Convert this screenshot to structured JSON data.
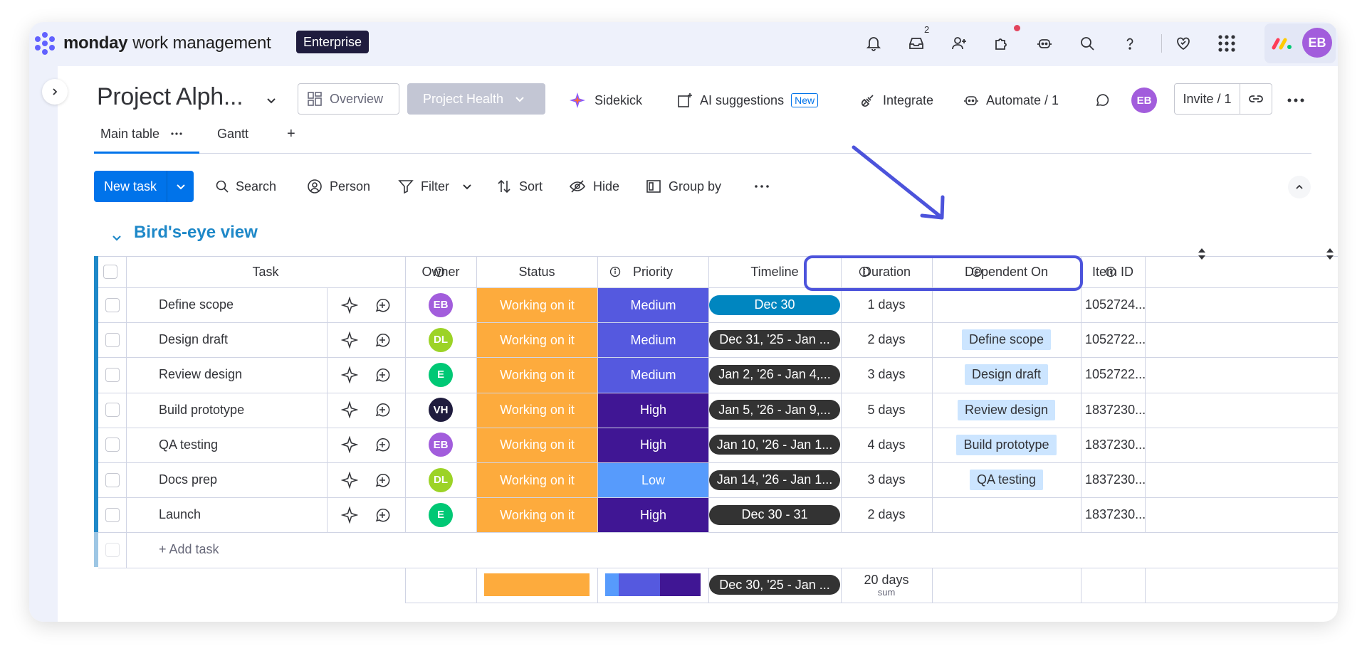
{
  "topbar": {
    "brand_bold": "monday",
    "brand_rest": "work management",
    "plan_badge": "Enterprise",
    "inbox_count": "2",
    "user_initials": "EB",
    "icons": [
      "bell-icon",
      "inbox-icon",
      "invite-person-icon",
      "puzzle-icon",
      "robot-icon",
      "search-icon",
      "help-icon",
      "heart-icon",
      "apps-grid-icon",
      "monday-logo-icon"
    ],
    "colors": {
      "avatar": "#a25ddc",
      "badge_bg": "#1f1c3e"
    }
  },
  "board": {
    "title": "Project Alph...",
    "overview_label": "Overview",
    "project_health_label": "Project Health",
    "sidekick_label": "Sidekick",
    "ai_suggestions_label": "AI suggestions",
    "ai_new_badge": "New",
    "integrate_label": "Integrate",
    "automate_label": "Automate / 1",
    "board_avatar": "EB",
    "invite_label": "Invite / 1"
  },
  "tabs": [
    {
      "label": "Main table",
      "active": true
    },
    {
      "label": "Gantt",
      "active": false
    }
  ],
  "add_tab_label": "+",
  "toolbar": {
    "new_task": "New task",
    "search": "Search",
    "person": "Person",
    "filter": "Filter",
    "sort": "Sort",
    "hide": "Hide",
    "group_by": "Group by"
  },
  "group": {
    "title": "Bird's-eye view",
    "color": "#1e88c8"
  },
  "columns": {
    "task": "Task",
    "owner": "Owner",
    "status": "Status",
    "priority": "Priority",
    "timeline": "Timeline",
    "duration": "Duration",
    "dependent_on": "Dependent On",
    "item_id": "Item ID"
  },
  "rows": [
    {
      "task": "Define scope",
      "owner": "EB",
      "owner_color": "#a25ddc",
      "status": "Working on it",
      "priority": "Medium",
      "priority_color": "#5559df",
      "timeline": "Dec 30",
      "timeline_color": "#0086c0",
      "duration": "1 days",
      "dependent": "",
      "item_id": "1052724..."
    },
    {
      "task": "Design draft",
      "owner": "DL",
      "owner_color": "#9cd326",
      "status": "Working on it",
      "priority": "Medium",
      "priority_color": "#5559df",
      "timeline": "Dec 31, '25 - Jan ...",
      "timeline_color": "#333333",
      "duration": "2 days",
      "dependent": "Define scope",
      "item_id": "1052722..."
    },
    {
      "task": "Review design",
      "owner": "E",
      "owner_color": "#00c875",
      "status": "Working on it",
      "priority": "Medium",
      "priority_color": "#5559df",
      "timeline": "Jan 2, '26 - Jan 4,...",
      "timeline_color": "#333333",
      "duration": "3 days",
      "dependent": "Design draft",
      "item_id": "1052722..."
    },
    {
      "task": "Build prototype",
      "owner": "VH",
      "owner_color": "#1f1c3e",
      "status": "Working on it",
      "priority": "High",
      "priority_color": "#401694",
      "timeline": "Jan 5, '26 - Jan 9,...",
      "timeline_color": "#333333",
      "duration": "5 days",
      "dependent": "Review design",
      "item_id": "1837230..."
    },
    {
      "task": "QA testing",
      "owner": "EB",
      "owner_color": "#a25ddc",
      "status": "Working on it",
      "priority": "High",
      "priority_color": "#401694",
      "timeline": "Jan 10, '26 - Jan 1...",
      "timeline_color": "#333333",
      "duration": "4 days",
      "dependent": "Build prototype",
      "item_id": "1837230..."
    },
    {
      "task": "Docs prep",
      "owner": "DL",
      "owner_color": "#9cd326",
      "status": "Working on it",
      "priority": "Low",
      "priority_color": "#579bfc",
      "timeline": "Jan 14, '26 - Jan 1...",
      "timeline_color": "#333333",
      "duration": "3 days",
      "dependent": "QA testing",
      "item_id": "1837230..."
    },
    {
      "task": "Launch",
      "owner": "E",
      "owner_color": "#00c875",
      "status": "Working on it",
      "priority": "High",
      "priority_color": "#401694",
      "timeline": "Dec 30 - 31",
      "timeline_color": "#333333",
      "duration": "2 days",
      "dependent": "",
      "item_id": "1837230..."
    }
  ],
  "add_task_label": "+ Add task",
  "summary": {
    "timeline": "Dec 30, '25 - Jan ...",
    "duration": "20 days",
    "duration_sub": "sum",
    "status_color": "#fdab3d",
    "priority_fractions": [
      {
        "color": "#579bfc",
        "fraction": 0.143
      },
      {
        "color": "#5559df",
        "fraction": 0.429
      },
      {
        "color": "#401694",
        "fraction": 0.428
      }
    ]
  },
  "annotation": {
    "color": "#4c53db"
  }
}
